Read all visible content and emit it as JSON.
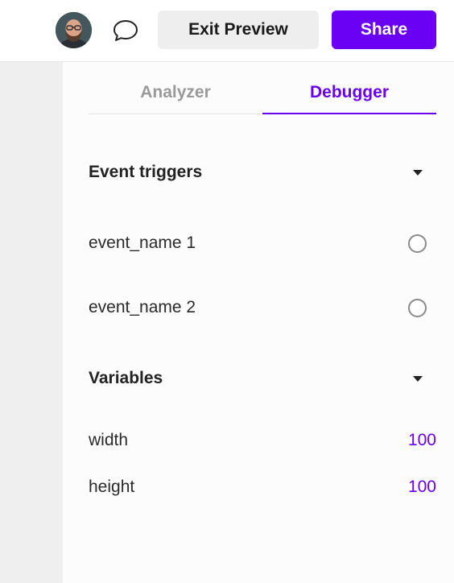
{
  "topbar": {
    "avatar_icon": "user-avatar",
    "comment_icon": "comment-icon",
    "exit_preview_label": "Exit Preview",
    "share_label": "Share"
  },
  "tabs": [
    {
      "label": "Analyzer",
      "active": false
    },
    {
      "label": "Debugger",
      "active": true
    }
  ],
  "event_triggers": {
    "title": "Event triggers",
    "items": [
      {
        "label": "event_name 1",
        "selected": false
      },
      {
        "label": "event_name 2",
        "selected": false
      }
    ]
  },
  "variables": {
    "title": "Variables",
    "items": [
      {
        "label": "width",
        "value": "100"
      },
      {
        "label": "height",
        "value": "100"
      }
    ]
  },
  "colors": {
    "accent": "#6a00f4",
    "rail": "#efefef",
    "exit_bg": "#eeeeee"
  }
}
